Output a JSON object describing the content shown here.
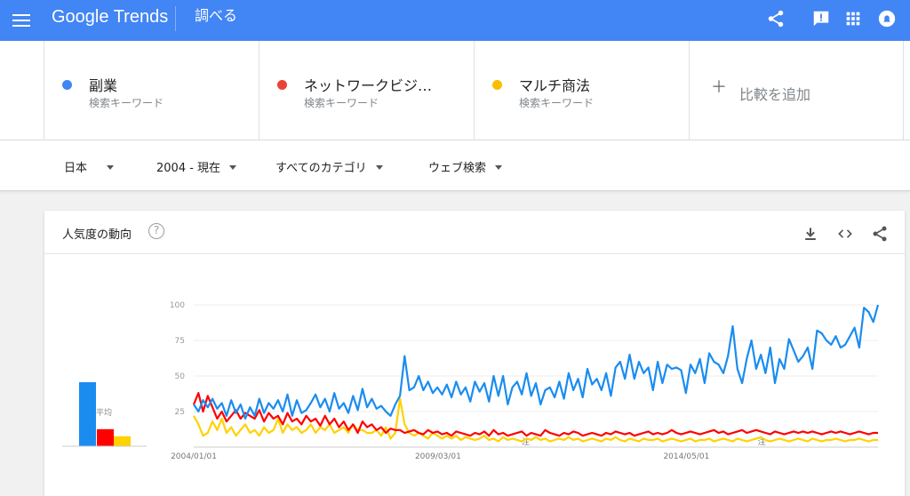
{
  "topbar": {
    "logo": "Google Trends",
    "explore": "調べる",
    "icons": [
      "menu-icon",
      "share-icon",
      "feedback-icon",
      "apps-icon",
      "account-icon"
    ]
  },
  "terms": [
    {
      "name": "副業",
      "sub": "検索キーワード",
      "color": "#4285f4"
    },
    {
      "name": "ネットワークビジ…",
      "sub": "検索キーワード",
      "color": "#ea4335"
    },
    {
      "name": "マルチ商法",
      "sub": "検索キーワード",
      "color": "#fbbc04"
    }
  ],
  "add_compare": "比較を追加",
  "filters": {
    "region": "日本",
    "period": "2004 - 現在",
    "category": "すべてのカテゴリ",
    "search_type": "ウェブ検索"
  },
  "card": {
    "title": "人気度の動向",
    "help": "?",
    "icons": [
      "download-icon",
      "embed-icon",
      "share-icon"
    ],
    "average_label": "平均"
  },
  "colors": {
    "blue": "#1a8cf0",
    "red": "#ff0000",
    "yellow": "#ffd200",
    "header": "#4285f4"
  },
  "chart_data": {
    "type": "line",
    "x_ticks": [
      "2004/01/01",
      "2009/03/01",
      "2014/05/01"
    ],
    "y_ticks": [
      100,
      75,
      50,
      25
    ],
    "ylim": [
      0,
      100
    ],
    "annotations": [
      "注",
      "注"
    ],
    "averages": [
      {
        "name": "副業",
        "value": 45
      },
      {
        "name": "ネットワークビジ…",
        "value": 12
      },
      {
        "name": "マルチ商法",
        "value": 7
      }
    ],
    "series": [
      {
        "name": "副業",
        "values": [
          30,
          25,
          33,
          28,
          34,
          27,
          31,
          22,
          33,
          24,
          30,
          20,
          28,
          22,
          34,
          24,
          31,
          27,
          33,
          25,
          37,
          22,
          33,
          24,
          26,
          31,
          37,
          28,
          34,
          25,
          38,
          27,
          31,
          24,
          36,
          26,
          41,
          28,
          34,
          27,
          29,
          25,
          22,
          30,
          36,
          64,
          40,
          42,
          50,
          40,
          46,
          38,
          42,
          37,
          44,
          35,
          46,
          37,
          42,
          32,
          46,
          39,
          45,
          32,
          50,
          36,
          50,
          30,
          42,
          46,
          37,
          52,
          36,
          45,
          30,
          40,
          42,
          35,
          46,
          34,
          52,
          40,
          48,
          35,
          55,
          44,
          48,
          40,
          52,
          36,
          56,
          60,
          48,
          65,
          48,
          60,
          52,
          56,
          40,
          60,
          45,
          58,
          55,
          56,
          54,
          38,
          58,
          52,
          62,
          45,
          66,
          60,
          58,
          52,
          64,
          85,
          55,
          45,
          62,
          75,
          55,
          65,
          52,
          70,
          45,
          62,
          55,
          76,
          68,
          60,
          64,
          70,
          55,
          82,
          80,
          75,
          72,
          78,
          70,
          72,
          78,
          84,
          70,
          98,
          95,
          88,
          100
        ]
      },
      {
        "name": "ネットワークビジ…",
        "values": [
          30,
          38,
          25,
          36,
          28,
          20,
          25,
          18,
          22,
          26,
          20,
          24,
          22,
          20,
          26,
          18,
          24,
          20,
          22,
          16,
          24,
          18,
          20,
          16,
          22,
          18,
          20,
          15,
          22,
          16,
          20,
          14,
          18,
          12,
          16,
          10,
          18,
          14,
          16,
          12,
          14,
          10,
          13,
          12,
          12,
          10,
          11,
          12,
          10,
          9,
          12,
          10,
          11,
          9,
          10,
          8,
          11,
          10,
          9,
          8,
          10,
          9,
          11,
          8,
          12,
          9,
          10,
          8,
          9,
          10,
          11,
          8,
          10,
          9,
          8,
          12,
          10,
          9,
          8,
          10,
          9,
          11,
          10,
          8,
          9,
          10,
          9,
          8,
          10,
          9,
          11,
          10,
          9,
          10,
          8,
          9,
          10,
          11,
          9,
          10,
          9,
          10,
          12,
          10,
          9,
          10,
          11,
          10,
          9,
          10,
          11,
          12,
          10,
          11,
          9,
          10,
          11,
          12,
          10,
          11,
          12,
          11,
          10,
          9,
          11,
          10,
          9,
          10,
          11,
          10,
          11,
          10,
          11,
          10,
          9,
          10,
          11,
          10,
          11,
          10,
          9,
          10,
          11,
          10,
          9,
          10,
          10
        ]
      },
      {
        "name": "マルチ商法",
        "values": [
          22,
          16,
          8,
          10,
          18,
          12,
          20,
          10,
          14,
          8,
          12,
          16,
          10,
          12,
          8,
          14,
          10,
          12,
          20,
          10,
          16,
          12,
          14,
          10,
          12,
          16,
          10,
          14,
          12,
          16,
          10,
          12,
          14,
          10,
          16,
          12,
          12,
          10,
          10,
          12,
          8,
          14,
          6,
          10,
          34,
          16,
          10,
          8,
          10,
          8,
          6,
          10,
          8,
          6,
          8,
          6,
          8,
          5,
          7,
          6,
          5,
          6,
          8,
          5,
          6,
          4,
          7,
          5,
          6,
          5,
          4,
          6,
          5,
          7,
          5,
          6,
          4,
          5,
          6,
          5,
          7,
          5,
          6,
          4,
          5,
          6,
          5,
          4,
          6,
          5,
          7,
          5,
          4,
          6,
          5,
          4,
          6,
          5,
          5,
          6,
          4,
          5,
          6,
          5,
          4,
          5,
          6,
          4,
          5,
          5,
          6,
          4,
          5,
          6,
          5,
          4,
          6,
          5,
          4,
          5,
          6,
          7,
          5,
          4,
          5,
          6,
          5,
          4,
          5,
          6,
          5,
          4,
          6,
          5,
          4,
          5,
          5,
          6,
          5,
          4,
          5,
          5,
          6,
          5,
          4,
          5,
          5
        ]
      }
    ]
  }
}
